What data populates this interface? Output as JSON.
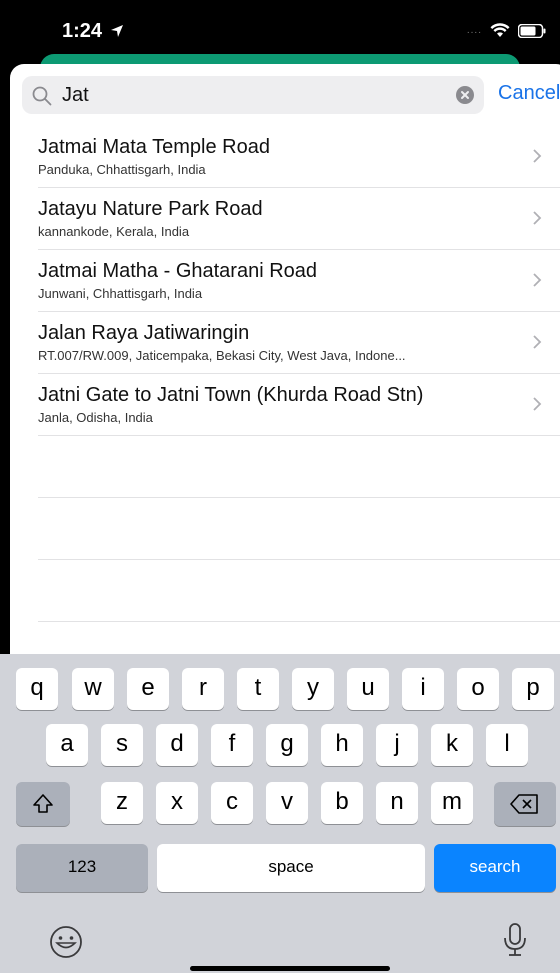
{
  "status_bar": {
    "time": "1:24",
    "signal_dots": "....",
    "icons": [
      "location-arrow-icon",
      "wifi-icon",
      "battery-icon"
    ]
  },
  "search": {
    "query": "Jat",
    "cancel_label": "Cancel"
  },
  "results": [
    {
      "title": "Jatmai Mata Temple Road",
      "subtitle": "Panduka, Chhattisgarh, India"
    },
    {
      "title": "Jatayu Nature Park Road",
      "subtitle": "kannankode, Kerala, India"
    },
    {
      "title": "Jatmai Matha - Ghatarani Road",
      "subtitle": "Junwani, Chhattisgarh, India"
    },
    {
      "title": "Jalan Raya Jatiwaringin",
      "subtitle": "RT.007/RW.009, Jaticempaka, Bekasi City, West Java, Indone..."
    },
    {
      "title": "Jatni Gate to Jatni Town (Khurda Road Stn)",
      "subtitle": "Janla, Odisha, India"
    }
  ],
  "keyboard": {
    "row1": [
      "q",
      "w",
      "e",
      "r",
      "t",
      "y",
      "u",
      "i",
      "o",
      "p"
    ],
    "row2": [
      "a",
      "s",
      "d",
      "f",
      "g",
      "h",
      "j",
      "k",
      "l"
    ],
    "row3": [
      "z",
      "x",
      "c",
      "v",
      "b",
      "n",
      "m"
    ],
    "numbers_label": "123",
    "space_label": "space",
    "search_label": "search"
  },
  "colors": {
    "accent": "#1a73e8",
    "search_key": "#0a84ff",
    "sheet_peek": "#0d9a73"
  }
}
